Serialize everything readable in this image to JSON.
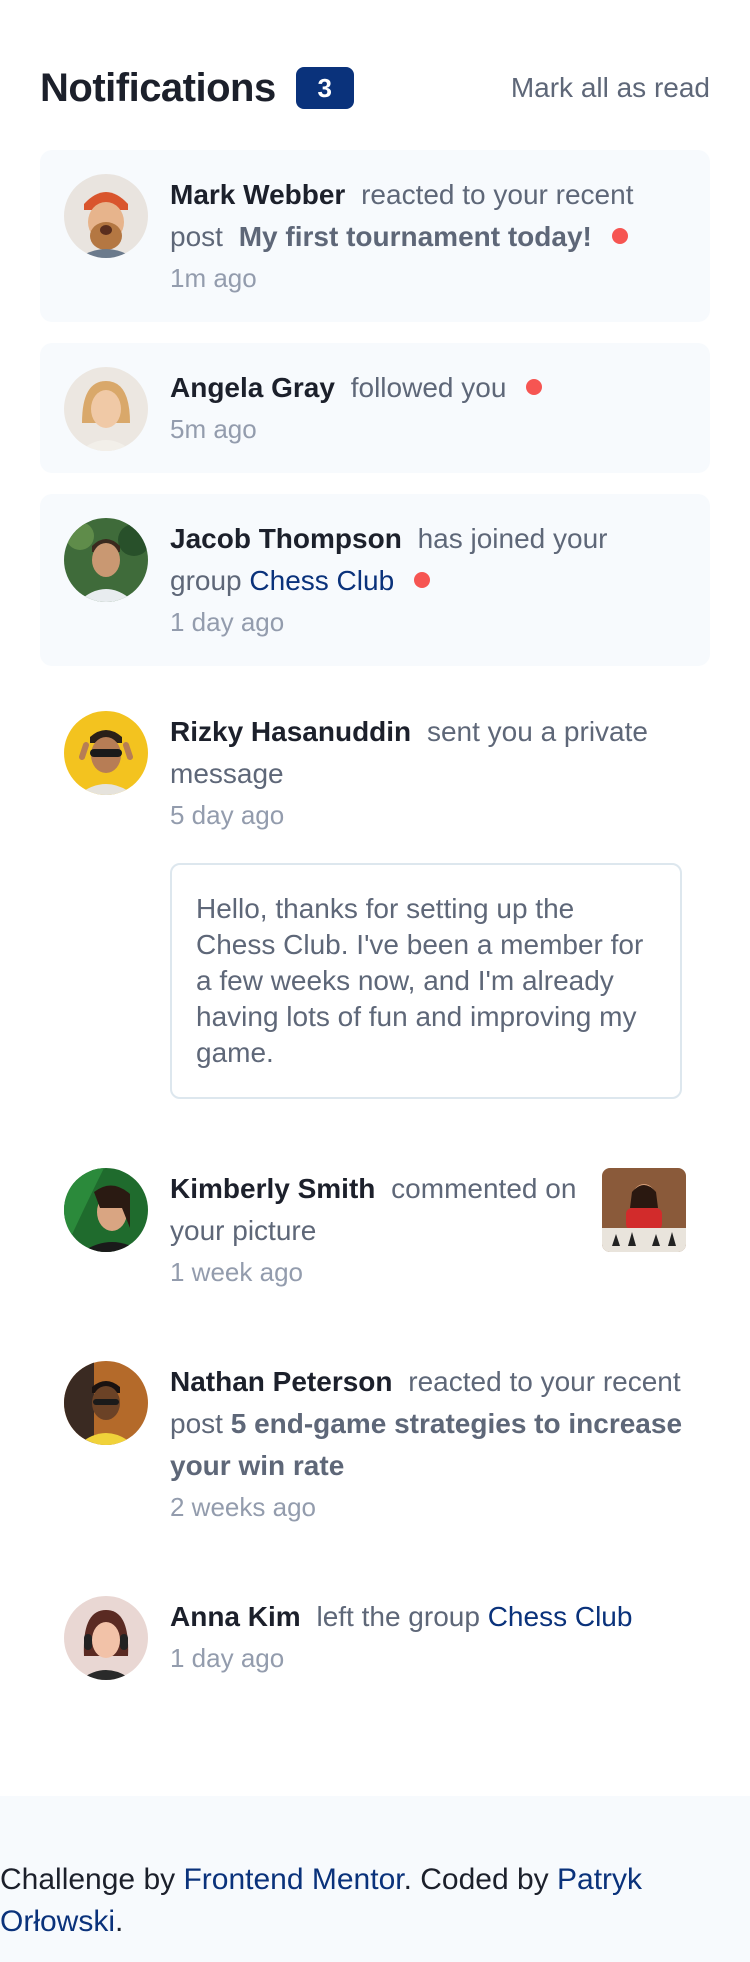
{
  "header": {
    "title": "Notifications",
    "count": "3",
    "mark_all": "Mark all as read"
  },
  "notifications": [
    {
      "name": "Mark Webber",
      "action": "reacted to your recent post",
      "post": "My first tournament today!",
      "time": "1m ago"
    },
    {
      "name": "Angela Gray",
      "action": "followed you",
      "time": "5m ago"
    },
    {
      "name": "Jacob Thompson",
      "action": "has joined your group",
      "group": "Chess Club",
      "time": "1 day ago"
    },
    {
      "name": "Rizky Hasanuddin",
      "action": "sent you a private message",
      "time": "5 day ago",
      "message": "Hello, thanks for setting up the Chess Club. I've been a member for a few weeks now, and I'm already having lots of fun and improving my game."
    },
    {
      "name": "Kimberly Smith",
      "action": "commented on your picture",
      "time": "1 week ago"
    },
    {
      "name": "Nathan Peterson",
      "action": "reacted to your recent post",
      "post": "5 end-game strategies to increase your win rate",
      "time": "2 weeks ago"
    },
    {
      "name": "Anna Kim",
      "action": "left the group",
      "group": "Chess Club",
      "time": "1 day ago"
    }
  ],
  "footer": {
    "prefix": "Challenge by",
    "link1": "Frontend Mentor",
    "middle": ". Coded by",
    "link2": "Patryk Orłowski",
    "suffix": "."
  },
  "colors": {
    "accent": "#0a327b",
    "unread_dot": "#f65552",
    "unread_bg": "#f7fafd"
  }
}
